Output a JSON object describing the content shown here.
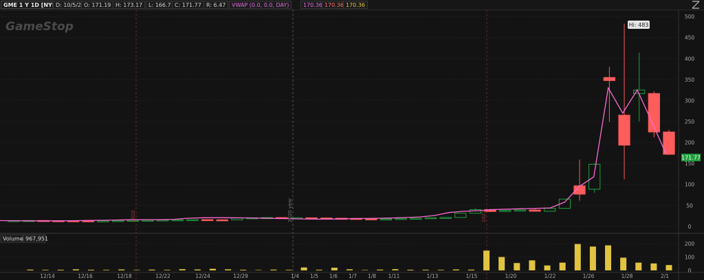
{
  "header": {
    "symbol": "GME 1 Y 1D [NYSE]",
    "date": "D: 10/5/21",
    "open": "O: 171.19",
    "high": "H: 173.17",
    "low": "L: 166.7",
    "close": "C: 171.77",
    "range": "R: 6.47",
    "vwap_label": "VWAP (0.0, 0.0, DAY)",
    "vwap_v1": "170.36",
    "vwap_v2": "170.36",
    "vwap_v3": "170.36"
  },
  "watermark": "GameStop",
  "annotations": {
    "hi_label": "Hi: 483",
    "last_price": "171.77",
    "marker_2020": "2020",
    "marker_year": "2020 year",
    "marker_2021": "2021"
  },
  "volume_panel": {
    "label": "Volume",
    "value": "967,951"
  },
  "colors": {
    "up": "#1fa23f",
    "down": "#ff5c5c",
    "vwap": "#ff6ad5",
    "volume": "#e0c341",
    "last_price_bg": "#1e9e3b"
  },
  "chart_data": [
    {
      "type": "candlestick",
      "y_ticks": [
        0,
        50,
        100,
        150,
        200,
        250,
        300,
        350,
        400,
        450,
        500
      ],
      "ylim": [
        -10,
        510
      ],
      "x_tick_labels": [
        "12/14",
        "12/16",
        "12/18",
        "12/22",
        "12/24",
        "12/29",
        "1/4",
        "1/5",
        "1/6",
        "1/7",
        "1/8",
        "1/11",
        "1/13",
        "1/15",
        "1/20",
        "1/22",
        "1/26",
        "1/28",
        "2/1"
      ],
      "ohlc": [
        [
          13.5,
          14,
          13.3,
          13.9
        ],
        [
          13.9,
          14.2,
          13.7,
          14
        ],
        [
          14,
          14.1,
          13.4,
          13.6
        ],
        [
          13.6,
          13.8,
          13.3,
          13.5
        ],
        [
          13.5,
          13.7,
          13.2,
          13.4
        ],
        [
          13.4,
          13.6,
          13.0,
          13.2
        ],
        [
          13.2,
          13.5,
          13.0,
          13.3
        ],
        [
          13.3,
          14,
          13.2,
          13.9
        ],
        [
          13.9,
          14.5,
          13.8,
          14.4
        ],
        [
          14.4,
          14.8,
          14.2,
          14.7
        ],
        [
          14.7,
          15.5,
          14.6,
          15.4
        ],
        [
          15.4,
          15.9,
          15.2,
          15.8
        ],
        [
          15.8,
          16.2,
          15.5,
          16.1
        ],
        [
          16.1,
          16.3,
          15.6,
          15.7
        ],
        [
          15.7,
          16.0,
          15.4,
          15.6
        ],
        [
          15.6,
          20.0,
          15.5,
          19.8
        ],
        [
          19.8,
          21.0,
          19.5,
          20.5
        ],
        [
          20.5,
          21.5,
          20.0,
          21.0
        ],
        [
          21.0,
          21.4,
          20.2,
          20.4
        ],
        [
          20.4,
          20.9,
          19.9,
          20.5
        ],
        [
          20.5,
          20.9,
          19.9,
          20.1
        ],
        [
          20.1,
          20.5,
          19.3,
          19.4
        ],
        [
          19.4,
          19.9,
          18.8,
          19.0
        ],
        [
          19.0,
          19.3,
          17.8,
          18.0
        ],
        [
          18.0,
          18.6,
          17.1,
          17.3
        ],
        [
          17.3,
          18.2,
          17.0,
          17.8
        ],
        [
          17.8,
          18.9,
          17.6,
          18.8
        ],
        [
          18.8,
          19.7,
          18.4,
          19.5
        ],
        [
          19.5,
          21.0,
          19.2,
          20.7
        ],
        [
          20.7,
          21.6,
          20.2,
          21.3
        ],
        [
          21.3,
          24.0,
          21.0,
          31.4
        ],
        [
          31.4,
          43.0,
          31.0,
          39.9
        ],
        [
          39.9,
          42.0,
          34.0,
          35.5
        ],
        [
          35.5,
          38.0,
          34.3,
          38.0
        ],
        [
          38.0,
          43.0,
          37.0,
          39.1
        ],
        [
          39.1,
          41.5,
          35.5,
          36.1
        ],
        [
          36.1,
          44.0,
          36.0,
          43.0
        ],
        [
          43.0,
          65.0,
          42.0,
          65.0
        ],
        [
          96.7,
          159.2,
          61.1,
          76.8
        ],
        [
          88.6,
          150.0,
          80.2,
          148.0
        ],
        [
          354.8,
          380.0,
          249.0,
          347.5
        ],
        [
          265.0,
          483.0,
          112.3,
          193.6
        ],
        [
          316.6,
          413.9,
          250.0,
          325.0
        ],
        [
          316.6,
          322.0,
          212.0,
          225.0
        ],
        [
          225.0,
          230.0,
          170.0,
          171.8
        ]
      ],
      "vwap_line": [
        13.7,
        13.6,
        13.4,
        13.3,
        13.3,
        13.5,
        14.0,
        14.5,
        15.2,
        15.8,
        16.0,
        15.8,
        16.8,
        19.5,
        20.5,
        20.7,
        20.5,
        20.3,
        19.8,
        19.0,
        18.5,
        17.6,
        17.2,
        17.5,
        18.3,
        18.8,
        19.2,
        20.0,
        21.0,
        22.5,
        26.0,
        33.0,
        36.0,
        37.5,
        40.0,
        41.0,
        42.0,
        43.0,
        44.0,
        58.0,
        95.0,
        118.0,
        330.0,
        270.0,
        325.0,
        250.0,
        172.0
      ]
    },
    {
      "type": "bar",
      "name": "Volume",
      "y_ticks": [
        0,
        100,
        200
      ],
      "ylim": [
        0,
        205
      ],
      "values": [
        6,
        4,
        5,
        8,
        5,
        4,
        7,
        3,
        6,
        4,
        9,
        7,
        12,
        8,
        5,
        3,
        6,
        4,
        22,
        5,
        20,
        8,
        3,
        6,
        9,
        5,
        5,
        4,
        7,
        6,
        148,
        100,
        55,
        75,
        37,
        58,
        197,
        178,
        187,
        95,
        58,
        52,
        40
      ]
    }
  ]
}
